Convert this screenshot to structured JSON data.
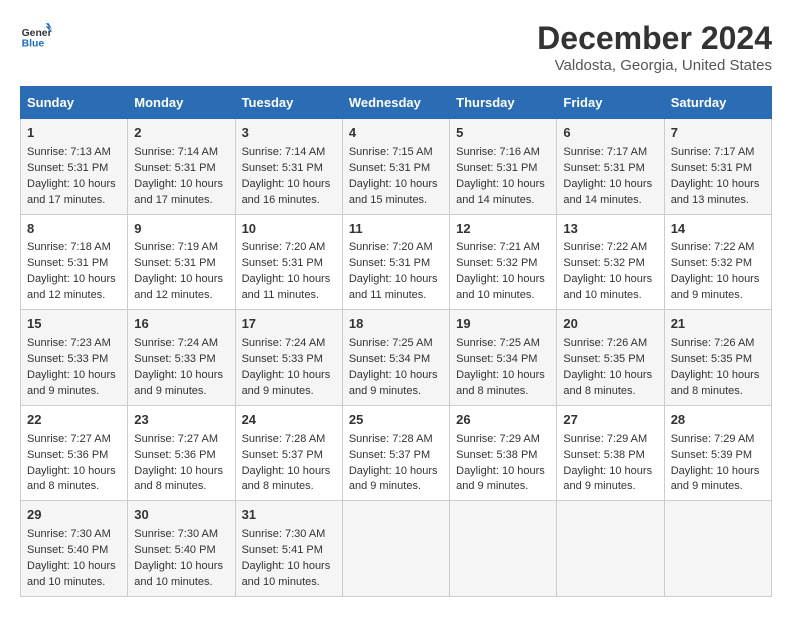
{
  "header": {
    "logo_line1": "General",
    "logo_line2": "Blue",
    "month_year": "December 2024",
    "location": "Valdosta, Georgia, United States"
  },
  "columns": [
    "Sunday",
    "Monday",
    "Tuesday",
    "Wednesday",
    "Thursday",
    "Friday",
    "Saturday"
  ],
  "weeks": [
    [
      {
        "day": "1",
        "sunrise": "7:13 AM",
        "sunset": "5:31 PM",
        "daylight": "10 hours and 17 minutes."
      },
      {
        "day": "2",
        "sunrise": "7:14 AM",
        "sunset": "5:31 PM",
        "daylight": "10 hours and 17 minutes."
      },
      {
        "day": "3",
        "sunrise": "7:14 AM",
        "sunset": "5:31 PM",
        "daylight": "10 hours and 16 minutes."
      },
      {
        "day": "4",
        "sunrise": "7:15 AM",
        "sunset": "5:31 PM",
        "daylight": "10 hours and 15 minutes."
      },
      {
        "day": "5",
        "sunrise": "7:16 AM",
        "sunset": "5:31 PM",
        "daylight": "10 hours and 14 minutes."
      },
      {
        "day": "6",
        "sunrise": "7:17 AM",
        "sunset": "5:31 PM",
        "daylight": "10 hours and 14 minutes."
      },
      {
        "day": "7",
        "sunrise": "7:17 AM",
        "sunset": "5:31 PM",
        "daylight": "10 hours and 13 minutes."
      }
    ],
    [
      {
        "day": "8",
        "sunrise": "7:18 AM",
        "sunset": "5:31 PM",
        "daylight": "10 hours and 12 minutes."
      },
      {
        "day": "9",
        "sunrise": "7:19 AM",
        "sunset": "5:31 PM",
        "daylight": "10 hours and 12 minutes."
      },
      {
        "day": "10",
        "sunrise": "7:20 AM",
        "sunset": "5:31 PM",
        "daylight": "10 hours and 11 minutes."
      },
      {
        "day": "11",
        "sunrise": "7:20 AM",
        "sunset": "5:31 PM",
        "daylight": "10 hours and 11 minutes."
      },
      {
        "day": "12",
        "sunrise": "7:21 AM",
        "sunset": "5:32 PM",
        "daylight": "10 hours and 10 minutes."
      },
      {
        "day": "13",
        "sunrise": "7:22 AM",
        "sunset": "5:32 PM",
        "daylight": "10 hours and 10 minutes."
      },
      {
        "day": "14",
        "sunrise": "7:22 AM",
        "sunset": "5:32 PM",
        "daylight": "10 hours and 9 minutes."
      }
    ],
    [
      {
        "day": "15",
        "sunrise": "7:23 AM",
        "sunset": "5:33 PM",
        "daylight": "10 hours and 9 minutes."
      },
      {
        "day": "16",
        "sunrise": "7:24 AM",
        "sunset": "5:33 PM",
        "daylight": "10 hours and 9 minutes."
      },
      {
        "day": "17",
        "sunrise": "7:24 AM",
        "sunset": "5:33 PM",
        "daylight": "10 hours and 9 minutes."
      },
      {
        "day": "18",
        "sunrise": "7:25 AM",
        "sunset": "5:34 PM",
        "daylight": "10 hours and 9 minutes."
      },
      {
        "day": "19",
        "sunrise": "7:25 AM",
        "sunset": "5:34 PM",
        "daylight": "10 hours and 8 minutes."
      },
      {
        "day": "20",
        "sunrise": "7:26 AM",
        "sunset": "5:35 PM",
        "daylight": "10 hours and 8 minutes."
      },
      {
        "day": "21",
        "sunrise": "7:26 AM",
        "sunset": "5:35 PM",
        "daylight": "10 hours and 8 minutes."
      }
    ],
    [
      {
        "day": "22",
        "sunrise": "7:27 AM",
        "sunset": "5:36 PM",
        "daylight": "10 hours and 8 minutes."
      },
      {
        "day": "23",
        "sunrise": "7:27 AM",
        "sunset": "5:36 PM",
        "daylight": "10 hours and 8 minutes."
      },
      {
        "day": "24",
        "sunrise": "7:28 AM",
        "sunset": "5:37 PM",
        "daylight": "10 hours and 8 minutes."
      },
      {
        "day": "25",
        "sunrise": "7:28 AM",
        "sunset": "5:37 PM",
        "daylight": "10 hours and 9 minutes."
      },
      {
        "day": "26",
        "sunrise": "7:29 AM",
        "sunset": "5:38 PM",
        "daylight": "10 hours and 9 minutes."
      },
      {
        "day": "27",
        "sunrise": "7:29 AM",
        "sunset": "5:38 PM",
        "daylight": "10 hours and 9 minutes."
      },
      {
        "day": "28",
        "sunrise": "7:29 AM",
        "sunset": "5:39 PM",
        "daylight": "10 hours and 9 minutes."
      }
    ],
    [
      {
        "day": "29",
        "sunrise": "7:30 AM",
        "sunset": "5:40 PM",
        "daylight": "10 hours and 10 minutes."
      },
      {
        "day": "30",
        "sunrise": "7:30 AM",
        "sunset": "5:40 PM",
        "daylight": "10 hours and 10 minutes."
      },
      {
        "day": "31",
        "sunrise": "7:30 AM",
        "sunset": "5:41 PM",
        "daylight": "10 hours and 10 minutes."
      },
      null,
      null,
      null,
      null
    ]
  ]
}
